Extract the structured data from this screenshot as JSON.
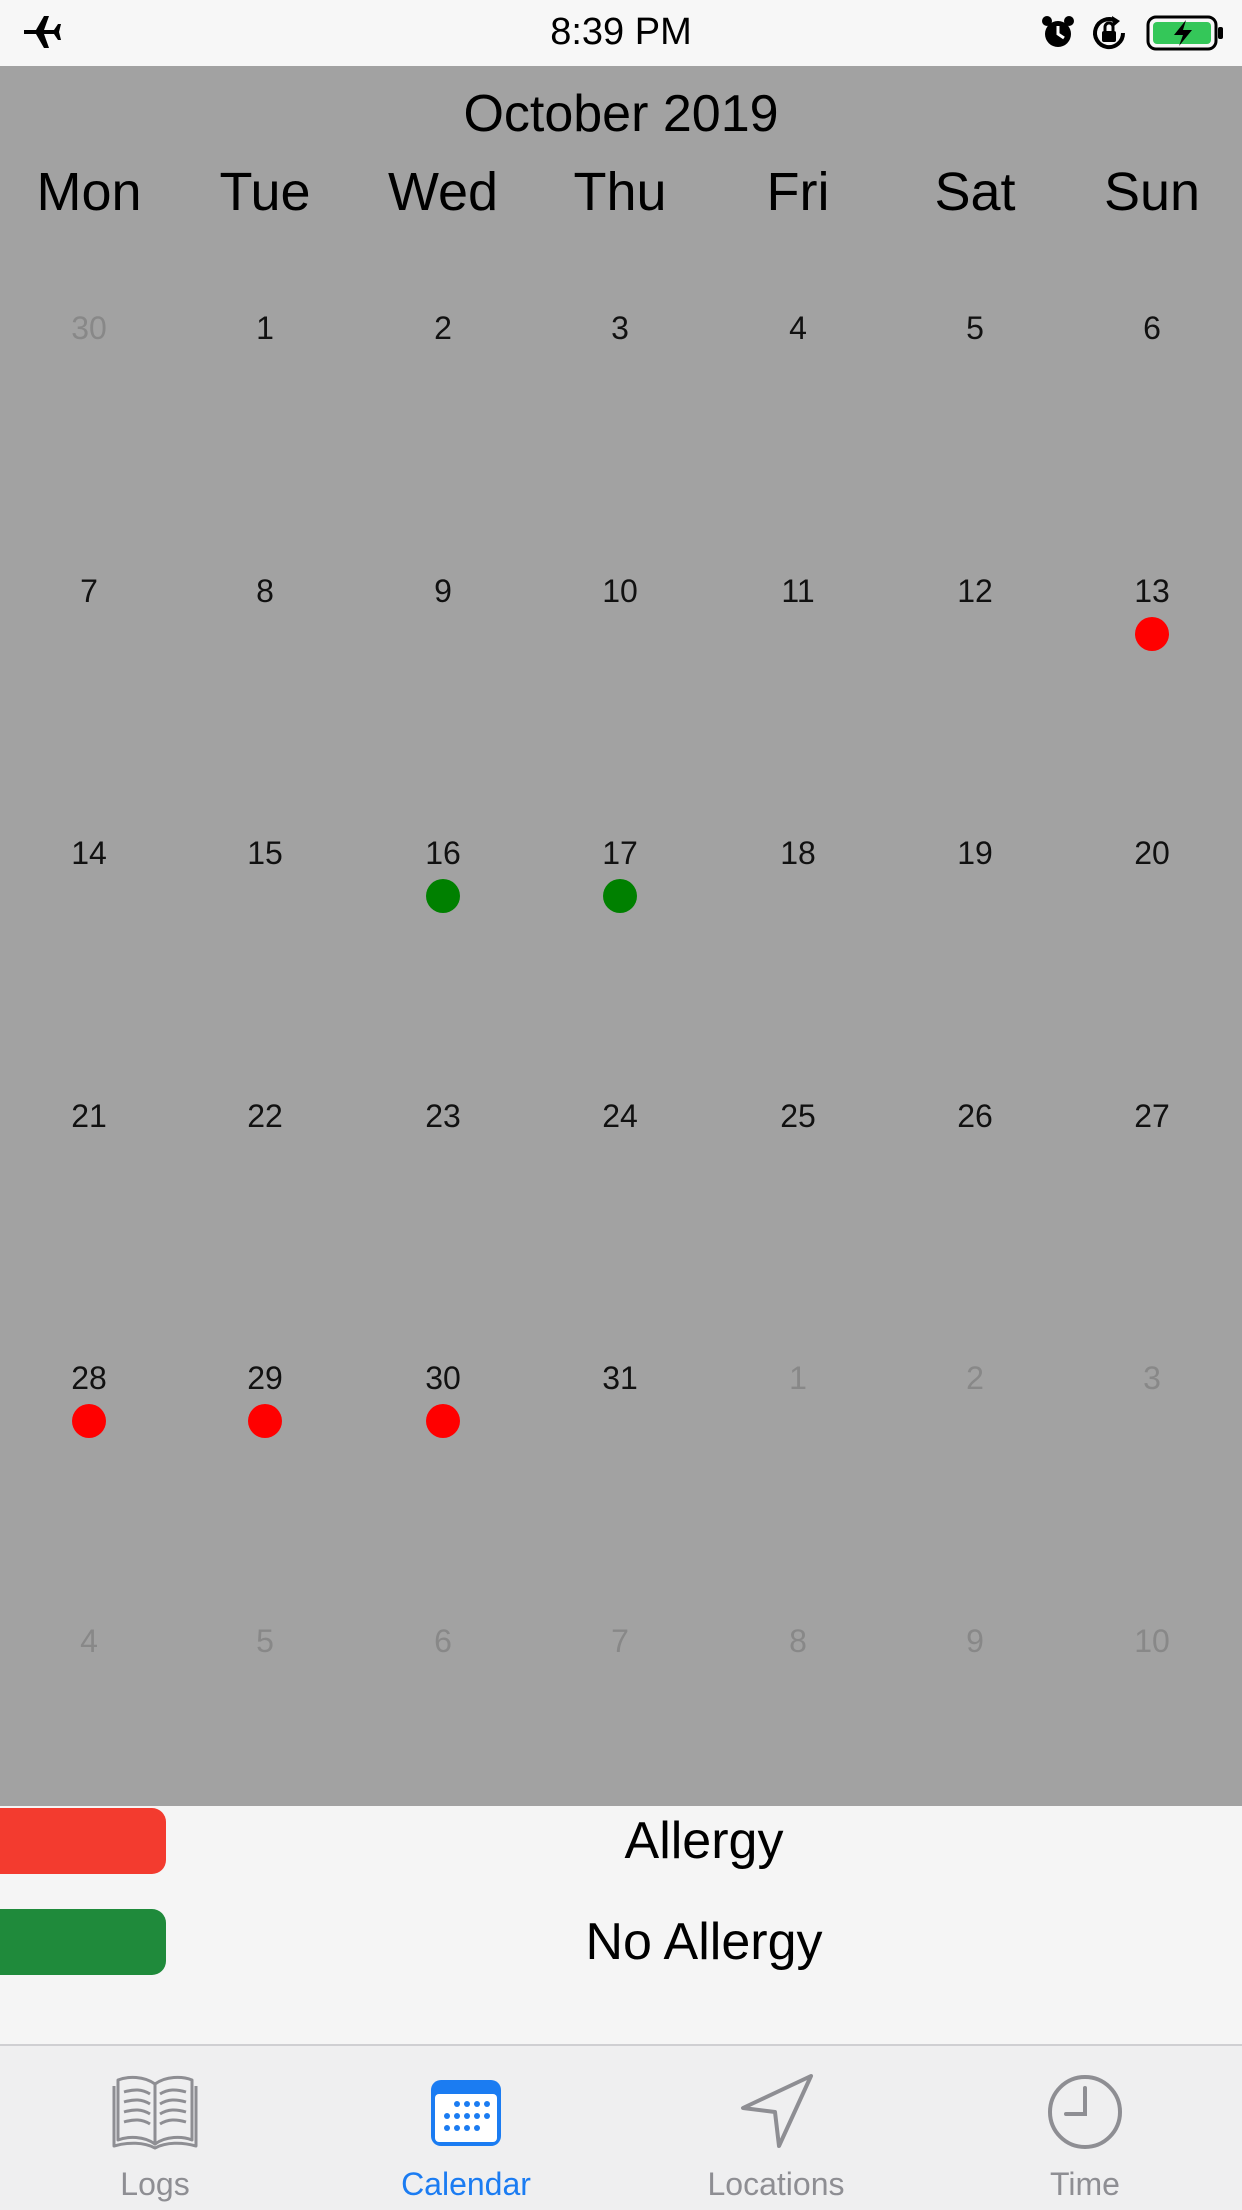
{
  "status_bar": {
    "time": "8:39 PM"
  },
  "calendar": {
    "month_title": "October 2019",
    "weekdays": [
      "Mon",
      "Tue",
      "Wed",
      "Thu",
      "Fri",
      "Sat",
      "Sun"
    ],
    "weeks": [
      [
        {
          "day": "30",
          "muted": true
        },
        {
          "day": "1"
        },
        {
          "day": "2"
        },
        {
          "day": "3"
        },
        {
          "day": "4"
        },
        {
          "day": "5"
        },
        {
          "day": "6"
        }
      ],
      [
        {
          "day": "7"
        },
        {
          "day": "8"
        },
        {
          "day": "9"
        },
        {
          "day": "10"
        },
        {
          "day": "11"
        },
        {
          "day": "12"
        },
        {
          "day": "13",
          "marker": "allergy"
        }
      ],
      [
        {
          "day": "14"
        },
        {
          "day": "15"
        },
        {
          "day": "16",
          "marker": "no_allergy"
        },
        {
          "day": "17",
          "marker": "no_allergy"
        },
        {
          "day": "18"
        },
        {
          "day": "19"
        },
        {
          "day": "20"
        }
      ],
      [
        {
          "day": "21"
        },
        {
          "day": "22"
        },
        {
          "day": "23"
        },
        {
          "day": "24"
        },
        {
          "day": "25"
        },
        {
          "day": "26"
        },
        {
          "day": "27"
        }
      ],
      [
        {
          "day": "28",
          "marker": "allergy"
        },
        {
          "day": "29",
          "marker": "allergy"
        },
        {
          "day": "30",
          "marker": "allergy"
        },
        {
          "day": "31"
        },
        {
          "day": "1",
          "muted": true
        },
        {
          "day": "2",
          "muted": true
        },
        {
          "day": "3",
          "muted": true
        }
      ],
      [
        {
          "day": "4",
          "muted": true
        },
        {
          "day": "5",
          "muted": true
        },
        {
          "day": "6",
          "muted": true
        },
        {
          "day": "7",
          "muted": true
        },
        {
          "day": "8",
          "muted": true
        },
        {
          "day": "9",
          "muted": true
        },
        {
          "day": "10",
          "muted": true
        }
      ]
    ],
    "marker_colors": {
      "allergy": "#ff0000",
      "no_allergy": "#008000"
    }
  },
  "legend": [
    {
      "label": "Allergy",
      "color": "#f33b2f"
    },
    {
      "label": "No Allergy",
      "color": "#1f8a3b"
    }
  ],
  "tab_bar": {
    "tabs": [
      {
        "label": "Logs",
        "icon": "book-icon",
        "active": false
      },
      {
        "label": "Calendar",
        "icon": "calendar-icon",
        "active": true
      },
      {
        "label": "Locations",
        "icon": "location-arrow-icon",
        "active": false
      },
      {
        "label": "Time",
        "icon": "clock-icon",
        "active": false
      }
    ],
    "active_color": "#1b7cf2",
    "inactive_color": "#8e8e93"
  }
}
